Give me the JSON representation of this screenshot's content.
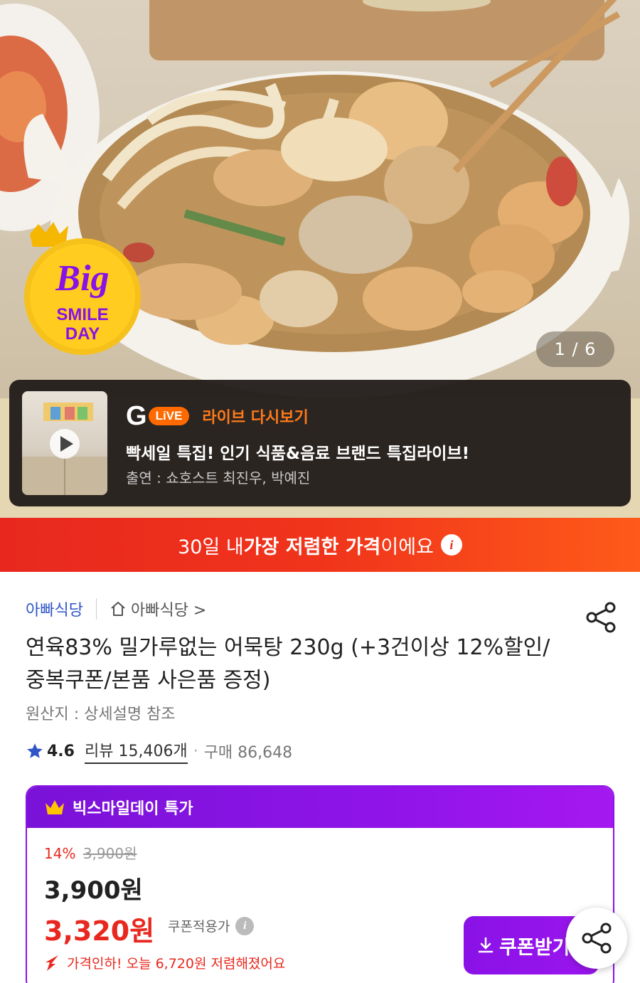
{
  "gallery": {
    "counter": "1 / 6",
    "badge": {
      "line1": "Big",
      "line2": "SMILE",
      "line3": "DAY"
    }
  },
  "live": {
    "logo_g": "G",
    "logo_live": "LiVE",
    "replay_label": "라이브 다시보기",
    "title": "빡세일 특집! 인기 식품&음료 브랜드 특집라이브!",
    "cast": "출연 : 쇼호스트 최진우, 박예진"
  },
  "banner": {
    "prefix": "30일 내 ",
    "highlight": "가장 저렴한 가격",
    "suffix": "이에요",
    "info_icon": "i"
  },
  "product": {
    "store_name": "아빠식당",
    "store_link": "아빠식당 >",
    "title": "연육83% 밀가루없는 어묵탕 230g (+3건이상 12%할인/중복쿠폰/본품 사은품 증정)",
    "origin": "원산지 : 상세설명 참조",
    "rating": "4.6",
    "reviews": "리뷰 15,406개",
    "separator": "·",
    "purchases": "구매 86,648"
  },
  "deal": {
    "header": "빅스마일데이 특가",
    "discount_pct": "14%",
    "original_price": "3,900원",
    "price": "3,900원",
    "coupon_price": "3,320원",
    "coupon_label": "쿠폰적용가",
    "coupon_info_icon": "i",
    "price_drop": "가격인하! 오늘 6,720원 저렴해졌어요",
    "coupon_button": "쿠폰받기"
  },
  "colors": {
    "accent_red": "#e8281e",
    "accent_purple": "#8a12e6",
    "live_orange": "#ff6a00",
    "store_blue": "#2f55c8"
  },
  "icons": [
    "crown-icon",
    "play-icon",
    "home-icon",
    "share-icon",
    "star-icon",
    "download-icon",
    "price-down-arrow-icon",
    "info-icon"
  ]
}
